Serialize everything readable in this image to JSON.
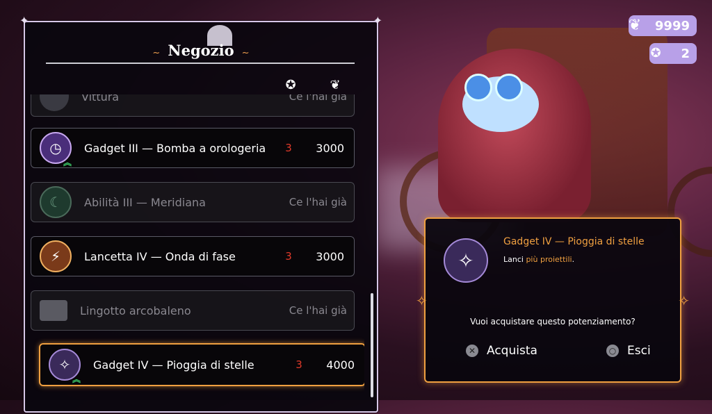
{
  "shop": {
    "title": "Negozio",
    "title_deco_left": "~",
    "title_deco_right": "~",
    "header_icons": [
      "star-badge-icon",
      "feather-icon"
    ],
    "partial_row": {
      "name": "Vittura",
      "status": "Ce l'hai già"
    },
    "rows": [
      {
        "name": "Gadget III — Bomba a orologeria",
        "count": "3",
        "price": "3000",
        "owned": false,
        "icon": "clock-bomb-icon"
      },
      {
        "name": "Abilità III — Meridiana",
        "status": "Ce l'hai già",
        "owned": true,
        "icon": "sundial-icon"
      },
      {
        "name": "Lancetta IV — Onda di fase",
        "count": "3",
        "price": "3000",
        "owned": false,
        "icon": "clock-hand-icon"
      },
      {
        "name": "Lingotto arcobaleno",
        "status": "Ce l'hai già",
        "owned": true,
        "icon": "ingot-icon"
      },
      {
        "name": "Gadget IV — Pioggia di stelle",
        "count": "3",
        "price": "4000",
        "owned": false,
        "selected": true,
        "icon": "star-rain-icon"
      }
    ]
  },
  "currency": {
    "feathers": "9999",
    "stars": "2"
  },
  "dialog": {
    "item_title": "Gadget IV — Pioggia di stelle",
    "desc_prefix": "Lanci ",
    "desc_highlight": "più proiettili",
    "desc_suffix": ".",
    "question": "Vuoi acquistare questo potenziamento?",
    "confirm_label": "Acquista",
    "cancel_label": "Esci"
  },
  "colors": {
    "accent": "#f0a040",
    "count_red": "#e03a2a",
    "upgrade_green": "#3ecf6a",
    "currency_bg": "#b8a0e8"
  }
}
